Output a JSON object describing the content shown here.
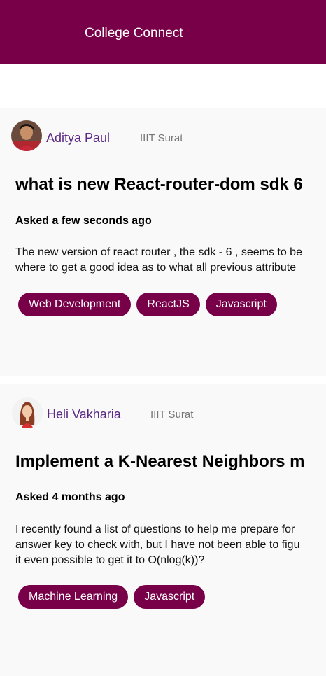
{
  "header": {
    "brand": "College Connect"
  },
  "colors": {
    "brand": "#770048",
    "author": "#5b2a86",
    "card_bg": "#f9f9f9"
  },
  "posts": [
    {
      "author": "Aditya Paul",
      "college": "IIIT Surat",
      "title": "what is new React-router-dom sdk 6",
      "asked": "Asked a few seconds ago",
      "body_lines": [
        "The new version of react router , the sdk - 6 , seems to be",
        "where to get a good idea as to what all previous attribute"
      ],
      "tags": [
        "Web Development",
        "ReactJS",
        "Javascript"
      ]
    },
    {
      "author": "Heli Vakharia",
      "college": "IIIT Surat",
      "title": "Implement a K-Nearest Neighbors m",
      "asked": "Asked 4 months ago",
      "body_lines": [
        "I recently found a list of questions to help me prepare for",
        "answer key to check with, but I have not been able to figu",
        "it even possible to get it to O(nlog(k))?"
      ],
      "tags": [
        "Machine Learning",
        "Javascript"
      ]
    }
  ]
}
